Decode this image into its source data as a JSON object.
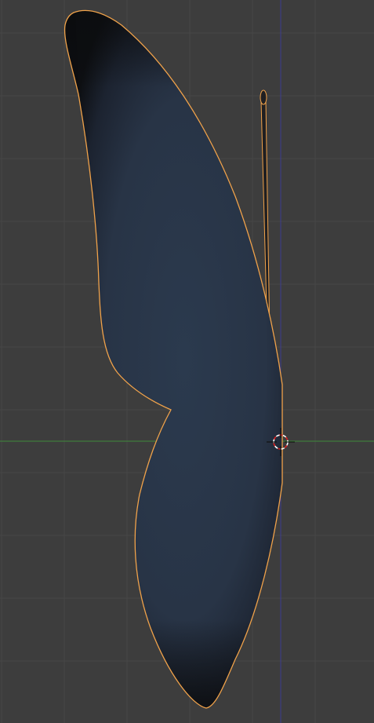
{
  "viewport": {
    "background": "#3d3d3d",
    "grid_color": "#464646",
    "x_axis_color": "#3f8a3a",
    "y_axis_color": "#3c3c8f",
    "grid_visible": true
  },
  "mesh": {
    "shape": "butterfly-wing",
    "selected": true,
    "fill_color": "#283446",
    "outline_color": "#f0a24a",
    "edge_shadow_color": "#0b0c0e",
    "antenna_color": "#1f1f22"
  },
  "cursor_3d": {
    "icon": "3d-cursor-icon",
    "ring_colors": [
      "#ffffff",
      "#e02020"
    ]
  }
}
